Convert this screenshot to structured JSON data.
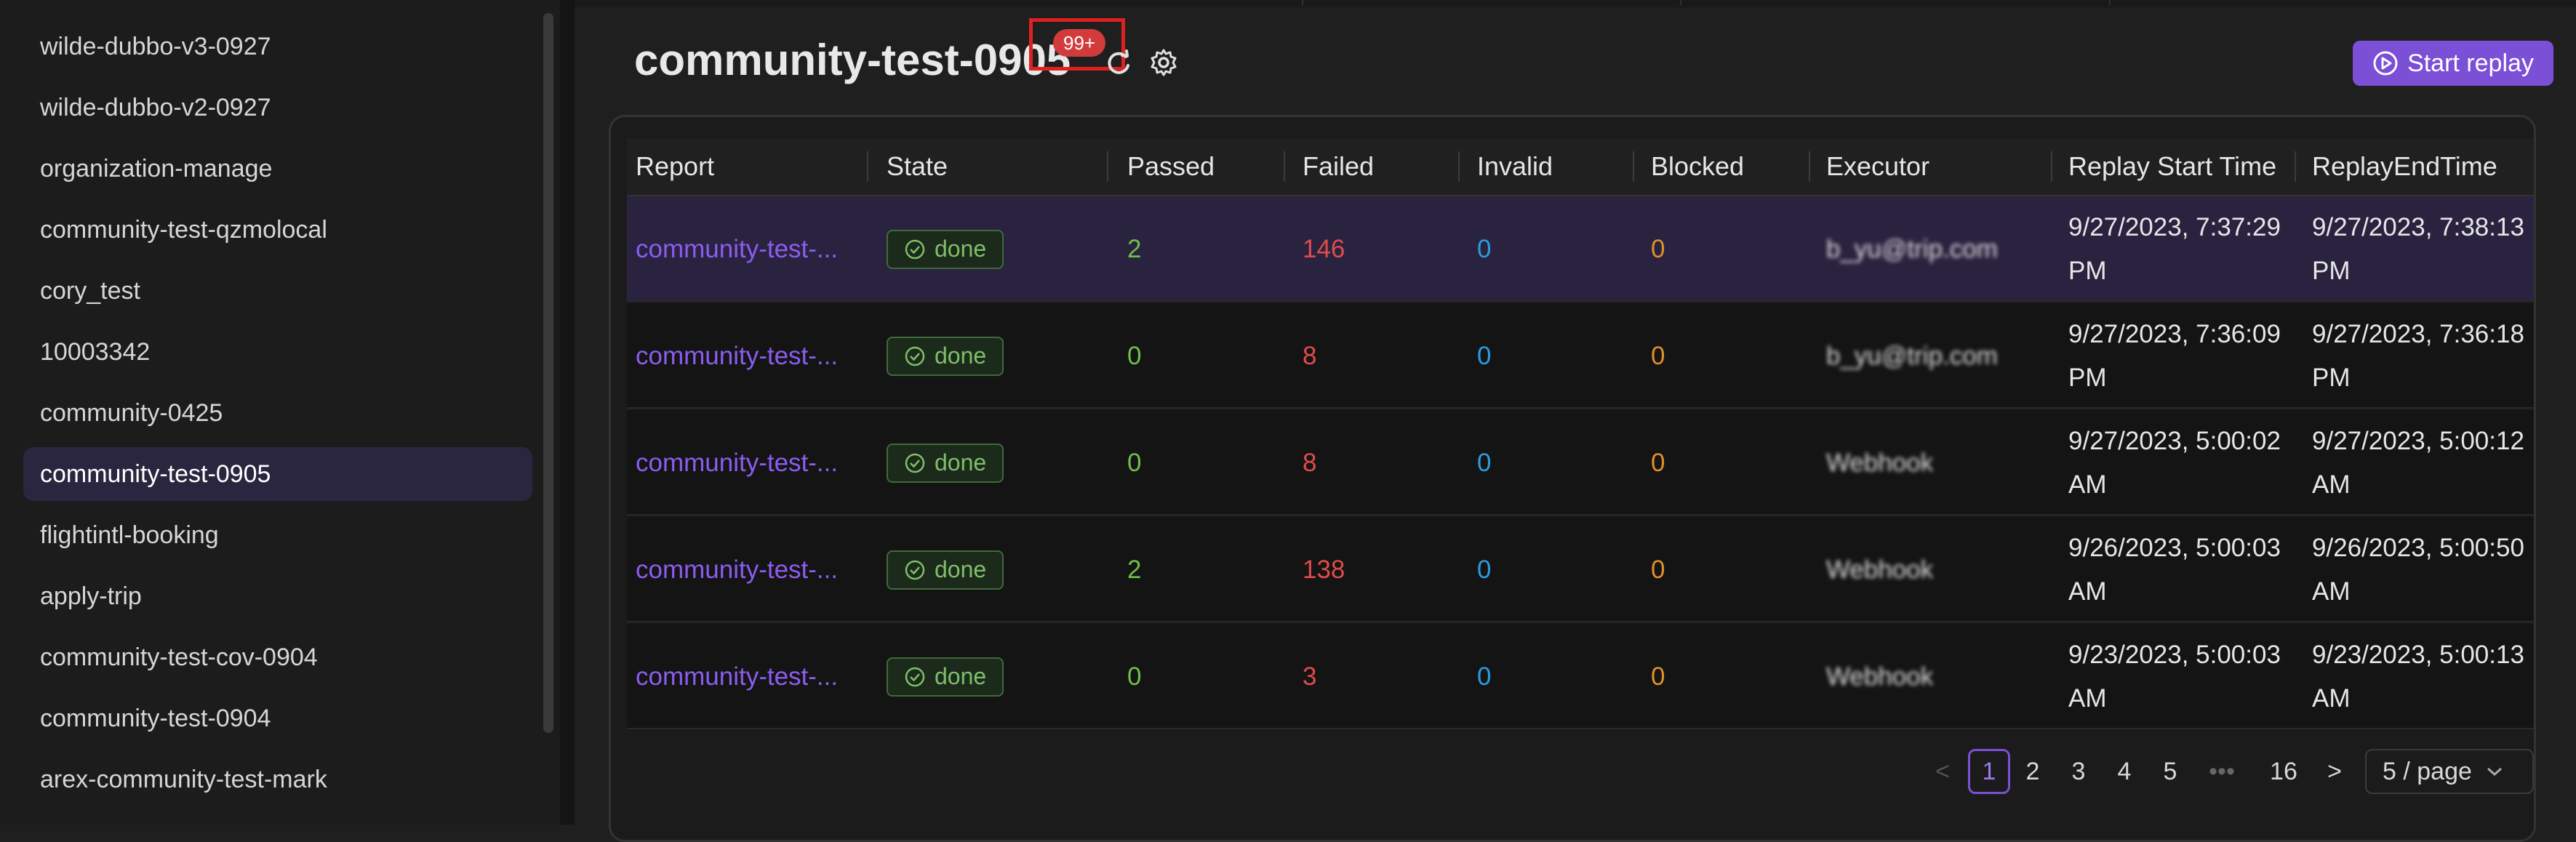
{
  "sidebar": {
    "items": [
      {
        "label": "wilde-dubbo-v3-0927"
      },
      {
        "label": "wilde-dubbo-v2-0927"
      },
      {
        "label": "organization-manage"
      },
      {
        "label": "community-test-qzmolocal"
      },
      {
        "label": "cory_test"
      },
      {
        "label": "10003342"
      },
      {
        "label": "community-0425"
      },
      {
        "label": "community-test-0905"
      },
      {
        "label": "flightintl-booking"
      },
      {
        "label": "apply-trip"
      },
      {
        "label": "community-test-cov-0904"
      },
      {
        "label": "community-test-0904"
      },
      {
        "label": "arex-community-test-mark"
      }
    ],
    "active_index": 7
  },
  "header": {
    "title": "community-test-0905",
    "badge": "99+",
    "start_replay_label": "Start replay",
    "accent_color": "#7b4fd6"
  },
  "table": {
    "columns": [
      "Report",
      "State",
      "Passed",
      "Failed",
      "Invalid",
      "Blocked",
      "Executor",
      "Replay Start Time",
      "ReplayEndTime"
    ],
    "rows": [
      {
        "report": "community-test-...",
        "state": "done",
        "passed": "2",
        "failed": "146",
        "invalid": "0",
        "blocked": "0",
        "executor": "b_yu@trip.com",
        "start": [
          "9/27/2023, 7:37:29",
          "PM"
        ],
        "end": [
          "9/27/2023, 7:38:13",
          "PM"
        ]
      },
      {
        "report": "community-test-...",
        "state": "done",
        "passed": "0",
        "failed": "8",
        "invalid": "0",
        "blocked": "0",
        "executor": "b_yu@trip.com",
        "start": [
          "9/27/2023, 7:36:09",
          "PM"
        ],
        "end": [
          "9/27/2023, 7:36:18",
          "PM"
        ]
      },
      {
        "report": "community-test-...",
        "state": "done",
        "passed": "0",
        "failed": "8",
        "invalid": "0",
        "blocked": "0",
        "executor": "Webhook",
        "start": [
          "9/27/2023, 5:00:02",
          "AM"
        ],
        "end": [
          "9/27/2023, 5:00:12",
          "AM"
        ]
      },
      {
        "report": "community-test-...",
        "state": "done",
        "passed": "2",
        "failed": "138",
        "invalid": "0",
        "blocked": "0",
        "executor": "Webhook",
        "start": [
          "9/26/2023, 5:00:03",
          "AM"
        ],
        "end": [
          "9/26/2023, 5:00:50",
          "AM"
        ]
      },
      {
        "report": "community-test-...",
        "state": "done",
        "passed": "0",
        "failed": "3",
        "invalid": "0",
        "blocked": "0",
        "executor": "Webhook",
        "start": [
          "9/23/2023, 5:00:03",
          "AM"
        ],
        "end": [
          "9/23/2023, 5:00:13",
          "AM"
        ]
      }
    ],
    "selected_row": 0
  },
  "pagination": {
    "prev": "<",
    "pages": [
      "1",
      "2",
      "3",
      "4",
      "5"
    ],
    "ellipsis": "•••",
    "last": "16",
    "next": ">",
    "current": "1",
    "page_size": "5 / page"
  }
}
